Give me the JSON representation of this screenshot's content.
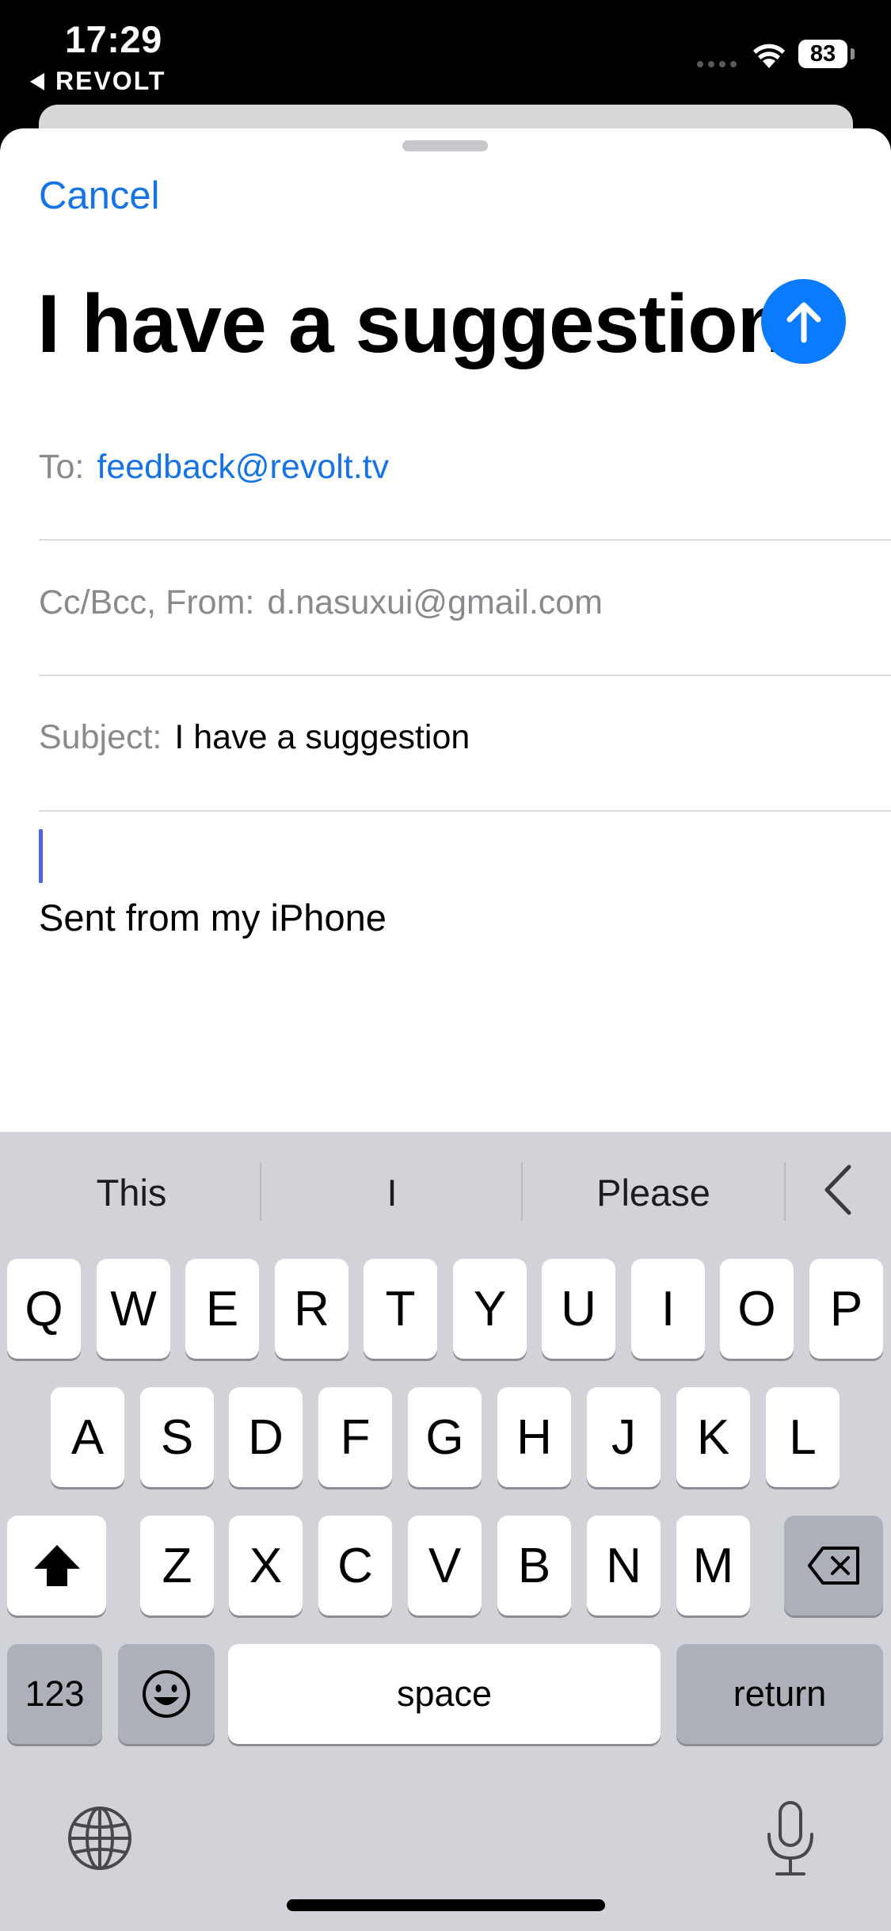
{
  "status": {
    "time": "17:29",
    "back_label": "REVOLT",
    "battery": "83"
  },
  "compose": {
    "cancel_label": "Cancel",
    "title": "I have a suggestion",
    "to_label": "To:",
    "to_value": "feedback@revolt.tv",
    "cc_label": "Cc/Bcc, From:",
    "cc_value": "d.nasuxui@gmail.com",
    "subject_label": "Subject:",
    "subject_value": "I have a suggestion",
    "body": "Sent from my iPhone"
  },
  "keyboard": {
    "suggestions": [
      "This",
      "I",
      "Please"
    ],
    "row1": [
      "Q",
      "W",
      "E",
      "R",
      "T",
      "Y",
      "U",
      "I",
      "O",
      "P"
    ],
    "row2": [
      "A",
      "S",
      "D",
      "F",
      "G",
      "H",
      "J",
      "K",
      "L"
    ],
    "row3": [
      "Z",
      "X",
      "C",
      "V",
      "B",
      "N",
      "M"
    ],
    "numbers_label": "123",
    "space_label": "space",
    "return_label": "return"
  },
  "colors": {
    "accent": "#1473e6",
    "send_button": "#0a7aff",
    "keyboard_bg": "#d1d3d9"
  },
  "icons": [
    "back-triangle-icon",
    "wifi-icon",
    "battery-icon",
    "send-arrow-icon",
    "chevron-left-icon",
    "shift-icon",
    "delete-icon",
    "emoji-icon",
    "globe-icon",
    "microphone-icon"
  ]
}
